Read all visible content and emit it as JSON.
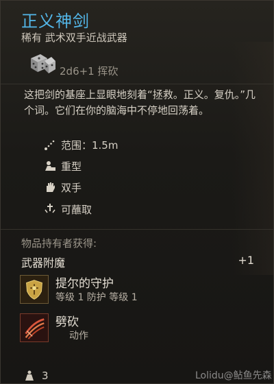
{
  "item": {
    "title": "正义神剑",
    "subtitle": "稀有 武术双手近战武器",
    "damage": "2d6+1 挥砍",
    "description": "这把剑的基座上显眼地刻着“拯救。正义。复仇。”几个词。它们在你的脑海中不停地回荡着。",
    "properties": [
      {
        "icon": "range-icon",
        "label": "范围：1.5m"
      },
      {
        "icon": "heavy-icon",
        "label": "重型"
      },
      {
        "icon": "two-handed-icon",
        "label": "双手"
      },
      {
        "icon": "dippable-icon",
        "label": "可蘸取"
      }
    ]
  },
  "granted": {
    "label": "物品持有者获得:",
    "enchant_title": "武器附魔",
    "enchant_value": "+1",
    "entries": [
      {
        "icon": "shield-emblem-icon",
        "name": "提尔的守护",
        "sub": "等级 1  防护  等级 1"
      },
      {
        "icon": "slash-icon",
        "name": "劈砍",
        "sub": "动作"
      }
    ]
  },
  "footer": {
    "weight": "3",
    "watermark": "Lolidu@鲇鱼先森"
  },
  "colors": {
    "title": "#53b6e8",
    "background": "#1b1a17",
    "gold_border": "#6d5a36"
  }
}
